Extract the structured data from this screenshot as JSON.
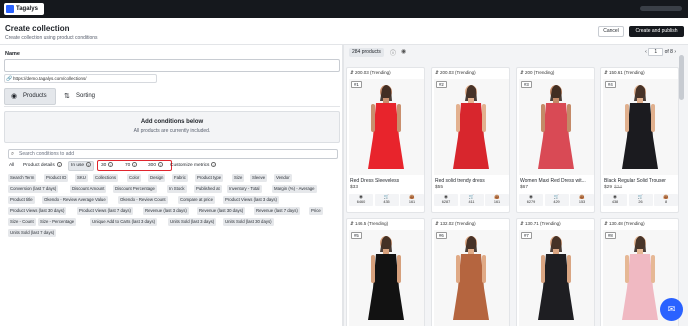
{
  "topbar": {
    "logo_text": "Tagalys"
  },
  "header": {
    "title": "Create collection",
    "subtitle": "Create collection using product conditions",
    "cancel_label": "Cancel",
    "create_label": "Create and publish"
  },
  "form": {
    "name_label": "Name",
    "name_value": "",
    "url_prefix": "https://demo.tagalys.com/collections/",
    "tabs": [
      {
        "label": "Products"
      },
      {
        "label": "Sorting"
      }
    ],
    "conditions_title": "Add conditions below",
    "conditions_sub": "All products are currently included.",
    "search_placeholder": "Search conditions to add",
    "filter_tabs": {
      "all": "All",
      "product_details": "Product details",
      "in_use": "In use",
      "customize": "Customize metrics"
    },
    "ranges": [
      "30",
      "70",
      "300"
    ],
    "chips": [
      "Search Term",
      "Product ID",
      "SKU",
      "Collections",
      "Color",
      "Design",
      "Fabric",
      "Product type",
      "Size",
      "Sleeve",
      "Vendor",
      "Conversion (last 7 days)",
      "Discount Amount",
      "Discount Percentage",
      "In Stock",
      "Published at",
      "Inventory - Total",
      "Margin (%) - Average",
      "Product title",
      "Okendo - Review Average Value",
      "Okendo - Review Count",
      "Compare at price",
      "Product Views (last 3 days)",
      "Product Views (last 30 days)",
      "Product Views (last 7 days)",
      "Revenue (last 3 days)",
      "Revenue (last 30 days)",
      "Revenue (last 7 days)",
      "Price",
      "Size - Count",
      "Size - Percentage",
      "Unique Add to Carts (last 3 days)",
      "Units Sold (last 3 days)",
      "Units Sold (last 30 days)",
      "Units Sold (last 7 days)"
    ]
  },
  "products_panel": {
    "count": "284 products",
    "page_value": "1",
    "page_total": "of 8",
    "cards": [
      {
        "trend": "200.03 (Trending)",
        "rank": "#1",
        "name": "Red Dress Sleeveless",
        "price": "$33",
        "compare": "",
        "stats": [
          "6460",
          "435",
          "161"
        ],
        "dress": "#e8242c",
        "skin": "#c98f6e"
      },
      {
        "trend": "200.03 (Trending)",
        "rank": "#2",
        "name": "Red solid trendy dress",
        "price": "$55",
        "compare": "",
        "stats": [
          "6287",
          "411",
          "161"
        ],
        "dress": "#d8262d",
        "skin": "#e3b18f"
      },
      {
        "trend": "200 (Trending)",
        "rank": "#3",
        "name": "Women Maxi Red Dress wit...",
        "price": "$67",
        "compare": "",
        "stats": [
          "6279",
          "429",
          "153"
        ],
        "dress": "#d94a55",
        "skin": "#c48a68"
      },
      {
        "trend": "150.61 (Trending)",
        "rank": "#4",
        "name": "Black Regular Solid Trouser",
        "price": "$29",
        "compare": "$34",
        "stats": [
          "438",
          "26",
          "8"
        ],
        "dress": "#1b1b1f",
        "skin": "#e0b08e"
      },
      {
        "trend": "146.5 (Trending)",
        "rank": "#5",
        "name": "",
        "price": "",
        "compare": "",
        "stats": [],
        "dress": "#121212",
        "skin": "#d6a07c"
      },
      {
        "trend": "132.02 (Trending)",
        "rank": "#6",
        "name": "",
        "price": "",
        "compare": "",
        "stats": [],
        "dress": "#b5653f",
        "skin": "#e0aa86"
      },
      {
        "trend": "130.71 (Trending)",
        "rank": "#7",
        "name": "",
        "price": "",
        "compare": "",
        "stats": [],
        "dress": "#1e1e22",
        "skin": "#d9a582"
      },
      {
        "trend": "130.48 (Trending)",
        "rank": "#8",
        "name": "",
        "price": "",
        "compare": "",
        "stats": [],
        "dress": "#f0b9c2",
        "skin": "#e6b895"
      }
    ]
  }
}
